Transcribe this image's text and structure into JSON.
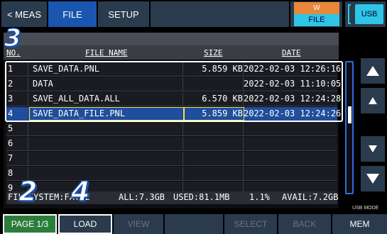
{
  "tabs": {
    "meas": "< MEAS",
    "file": "FILE",
    "setup": "SETUP"
  },
  "status": {
    "w_badge": "W",
    "file_badge": "FILE",
    "usb": "USB"
  },
  "table": {
    "headers": {
      "no": "NO.",
      "name": "FILE NAME",
      "size": "SIZE",
      "date": "DATE"
    },
    "rows": [
      {
        "no": "1",
        "name": "SAVE_DATA.PNL",
        "size": "5.859 KB",
        "date": "2022-02-03 12:26:16"
      },
      {
        "no": "2",
        "name": "DATA",
        "size": "",
        "date": "2022-02-03 11:10:05"
      },
      {
        "no": "3",
        "name": "SAVE_ALL_DATA.ALL",
        "size": "6.570 KB",
        "date": "2022-02-03 12:24:28"
      },
      {
        "no": "4",
        "name": "SAVE_DATA_FILE.PNL",
        "size": "5.859 KB",
        "date": "2022-02-03 12:24:26"
      },
      {
        "no": "5",
        "name": "",
        "size": "",
        "date": ""
      },
      {
        "no": "6",
        "name": "",
        "size": "",
        "date": ""
      },
      {
        "no": "7",
        "name": "",
        "size": "",
        "date": ""
      },
      {
        "no": "8",
        "name": "",
        "size": "",
        "date": ""
      },
      {
        "no": "9",
        "name": "",
        "size": "",
        "date": ""
      }
    ],
    "selected_row": "4"
  },
  "filesystem": {
    "type": "FILESYSTEM:FAT32",
    "all": "ALL:7.3GB",
    "used": "USED:81.1MB",
    "percent": "1.1%",
    "avail": "AVAIL:7.2GB"
  },
  "usb_mode": "USB MODE",
  "bottom": {
    "page": "PAGE 1/3",
    "load": "LOAD",
    "view": "VIEW",
    "select": "SELECT",
    "back": "BACK",
    "mem": "MEM"
  },
  "callouts": {
    "c3": "3",
    "c2": "2",
    "c4": "4"
  },
  "colors": {
    "accent": "#1a56b0",
    "selection": "#1f4e9c",
    "page_button": "#2c7d3c",
    "usb": "#2fc4e8",
    "warning": "#e8873a"
  }
}
